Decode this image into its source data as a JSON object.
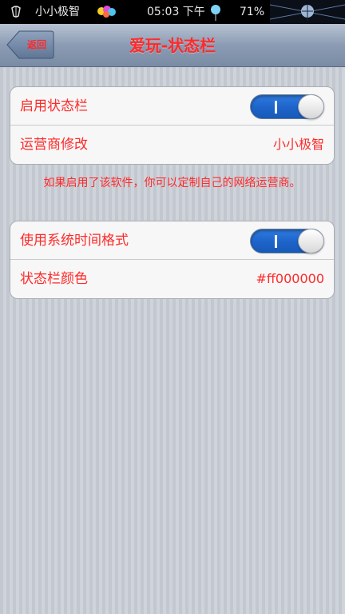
{
  "statusbar": {
    "carrier": "小小极智",
    "time": "05:03 下午",
    "battery": "71%"
  },
  "navbar": {
    "back_label": "返回",
    "title": "爱玩-状态栏"
  },
  "group1": {
    "rows": [
      {
        "label": "启用状态栏",
        "toggle_on": true
      },
      {
        "label": "运营商修改",
        "value": "小小极智"
      }
    ]
  },
  "hint": "如果启用了该软件，你可以定制自己的网络运营商。",
  "group2": {
    "rows": [
      {
        "label": "使用系统时间格式",
        "toggle_on": true
      },
      {
        "label": "状态栏颜色",
        "value": "#ff000000"
      }
    ]
  },
  "colors": {
    "accent": "#ff2a2a",
    "toggle_on": "#1d63c9"
  }
}
